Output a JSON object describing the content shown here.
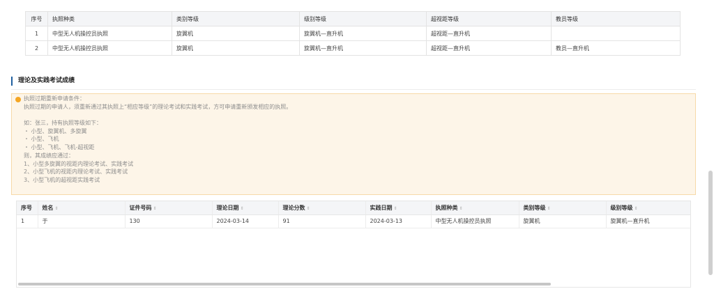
{
  "license_table": {
    "headers": [
      "序号",
      "执照种类",
      "类别等级",
      "级别等级",
      "超视距等级",
      "教员等级"
    ],
    "rows": [
      [
        "1",
        "中型无人机操控员执照",
        "旋翼机",
        "旋翼机—直升机",
        "超视距—直升机",
        ""
      ],
      [
        "2",
        "中型无人机操控员执照",
        "旋翼机",
        "旋翼机—直升机",
        "超视距—直升机",
        "教员—直升机"
      ]
    ]
  },
  "section": {
    "title": "理论及实践考试成绩"
  },
  "notice": {
    "color": "#f5a623",
    "lines": [
      "执照过期重新申请条件：",
      "执照过期的申请人，须重新通过其执照上“相应等级”的理论考试和实践考试，方可申请重新颁发相应的执照。",
      "",
      "如：张三，持有执照等级如下：",
      "・ 小型、旋翼机、多旋翼",
      "・ 小型、飞机",
      "・ 小型、飞机、飞机-超视距",
      "则，其成绩应通过：",
      "  1、小型多旋翼的视距内理论考试、实践考试",
      "  2、小型飞机的视距内理论考试、实践考试",
      "  3、小型飞机的超视距实践考试"
    ]
  },
  "score_table": {
    "headers": [
      "序号",
      "姓名",
      "证件号码",
      "理论日期",
      "理论分数",
      "实践日期",
      "执照种类",
      "类别等级",
      "级别等级"
    ],
    "rows": [
      [
        "1",
        "于",
        "130",
        "2024-03-14",
        "91",
        "2024-03-13",
        "中型无人机操控员执照",
        "旋翼机",
        "旋翼机—直升机"
      ]
    ]
  }
}
